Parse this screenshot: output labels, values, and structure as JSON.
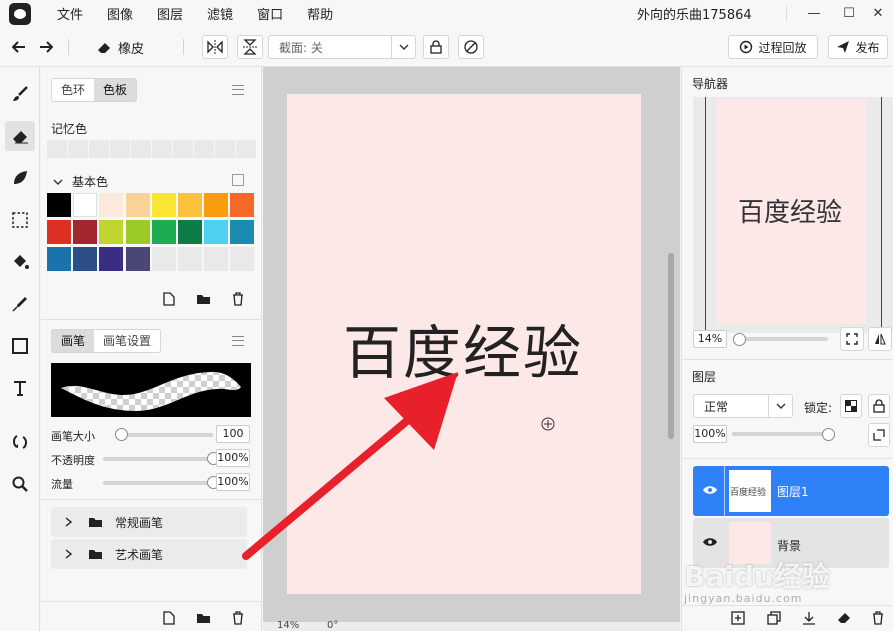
{
  "menubar": {
    "items": [
      "文件",
      "图像",
      "图层",
      "滤镜",
      "窗口",
      "帮助"
    ],
    "doc_title": "外向的乐曲175864",
    "win_minimize": "—",
    "win_maximize": "☐",
    "win_close": "✕"
  },
  "toolbar": {
    "eraser_label": "橡皮",
    "section_label": "截面: 关",
    "replay_label": "过程回放",
    "publish_label": "发布"
  },
  "color_panel": {
    "tabs": [
      "色环",
      "色板"
    ],
    "active_tab": "色板",
    "recent_label": "记忆色",
    "basic_label": "基本色",
    "swatches": [
      "#000000",
      "#ffffff",
      "#fde9dc",
      "#fbd19a",
      "#f9e532",
      "#fcc23e",
      "#f99d0e",
      "#f4682a",
      "#de3022",
      "#a2282d",
      "#c2d52e",
      "#9cca27",
      "#1fab4f",
      "#0c7b45",
      "#4ed0f2",
      "#1b8bb0",
      "#1c72ad",
      "#2b4f88",
      "#3b2c85",
      "#4a4678"
    ]
  },
  "brush_panel": {
    "tabs": [
      "画笔",
      "画笔设置"
    ],
    "active_tab": "画笔",
    "size_label": "画笔大小",
    "size_value": "100",
    "size_fraction": 0.04,
    "opacity_label": "不透明度",
    "opacity_value": "100%",
    "opacity_fraction": 1.0,
    "flow_label": "流量",
    "flow_value": "100%",
    "flow_fraction": 1.0,
    "folders": [
      "常规画笔",
      "艺术画笔"
    ]
  },
  "canvas": {
    "text": "百度经验",
    "zoom": "14%",
    "rotation": "0°"
  },
  "navigator": {
    "title": "导航器",
    "text": "百度经验",
    "zoom": "14%",
    "zoom_fraction": 0.05
  },
  "layers": {
    "title": "图层",
    "blend_mode": "正常",
    "lock_label": "锁定:",
    "opacity": "100%",
    "opacity_fraction": 1.0,
    "items": [
      {
        "name": "图层1",
        "thumb_text": "百度经验",
        "selected": true
      },
      {
        "name": "背景",
        "selected": false
      }
    ]
  },
  "colors": {
    "accent": "#2f81f7",
    "arrow": "#e8202b",
    "paper": "#fde8e8"
  },
  "watermark": {
    "line1": "Baidu经验",
    "line2": "jingyan.baidu.com"
  }
}
